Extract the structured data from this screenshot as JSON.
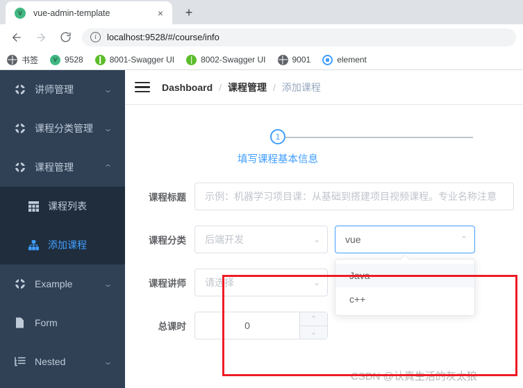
{
  "browser": {
    "tab": {
      "title": "vue-admin-template",
      "favicon": "vue-icon",
      "close": "×"
    },
    "new_tab_label": "+",
    "url": "localhost:9528/#/course/info",
    "bookmarks": [
      {
        "label": "书签",
        "icon": "globe-icon"
      },
      {
        "label": "9528",
        "icon": "vue-icon"
      },
      {
        "label": "8001-Swagger UI",
        "icon": "swagger-icon"
      },
      {
        "label": "8002-Swagger UI",
        "icon": "swagger-icon"
      },
      {
        "label": "9001",
        "icon": "globe-icon"
      },
      {
        "label": "element",
        "icon": "element-icon"
      }
    ]
  },
  "sidebar": {
    "items": [
      {
        "label": "讲师管理",
        "icon": "gear-icon",
        "arrow": "⌄",
        "expanded": false
      },
      {
        "label": "课程分类管理",
        "icon": "gear-icon",
        "arrow": "⌄",
        "expanded": false
      },
      {
        "label": "课程管理",
        "icon": "gear-icon",
        "arrow": "⌃",
        "expanded": true
      }
    ],
    "submenu": [
      {
        "label": "课程列表",
        "icon": "table-icon",
        "active": false
      },
      {
        "label": "添加课程",
        "icon": "tree-icon",
        "active": true
      }
    ],
    "items_after": [
      {
        "label": "Example",
        "icon": "gear-icon",
        "arrow": "⌄"
      },
      {
        "label": "Form",
        "icon": "form-icon",
        "arrow": ""
      },
      {
        "label": "Nested",
        "icon": "nested-icon",
        "arrow": "⌄"
      }
    ]
  },
  "navbar": {
    "hamburger": "hamburger-icon",
    "breadcrumb": [
      {
        "label": "Dashboard",
        "current": false
      },
      {
        "label": "课程管理",
        "current": false
      },
      {
        "label": "添加课程",
        "current": true
      }
    ],
    "separator": "/"
  },
  "steps": {
    "number": "1",
    "title": "填写课程基本信息"
  },
  "form": {
    "title_row": {
      "label": "课程标题",
      "placeholder": "示例：机器学习项目课：从基础到搭建项目视频课程。专业名称注意",
      "value": ""
    },
    "category_row": {
      "label": "课程分类",
      "parent_value": "后端开发",
      "parent_arrow": "⌄",
      "child_value": "vue",
      "child_arrow": "⌃",
      "dropdown_options": [
        {
          "label": "Java",
          "hovered": true
        },
        {
          "label": "c++",
          "hovered": false
        }
      ]
    },
    "teacher_row": {
      "label": "课程讲师",
      "placeholder": "请选择",
      "arrow": "⌄"
    },
    "lessons_row": {
      "label": "总课时",
      "value": "0",
      "up": "⌃",
      "down": "⌄"
    }
  },
  "annotation": {
    "watermark": "CSDN @认真生活的灰太狼",
    "box_color": "#ee1b24"
  },
  "colors": {
    "sidebar_bg": "#304156",
    "submenu_bg": "#1f2d3d",
    "accent": "#409eff",
    "text_muted": "#c0c4cc"
  }
}
